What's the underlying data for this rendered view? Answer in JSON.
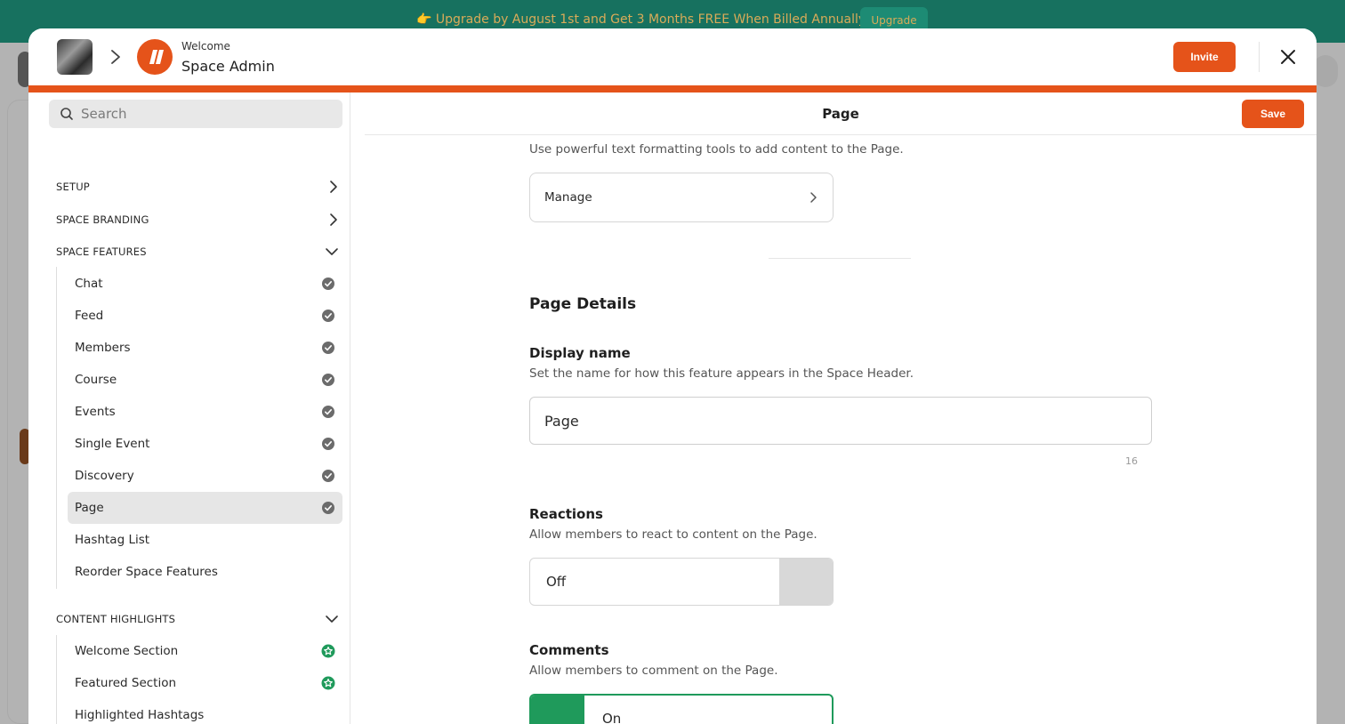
{
  "background": {
    "banner_text": "👉 Upgrade by August 1st and Get 3 Months FREE When Billed Annually",
    "banner_button": "Upgrade"
  },
  "header": {
    "breadcrumb_sub": "Welcome",
    "breadcrumb_title": "Space Admin",
    "invite_label": "Invite",
    "accent_color": "#e5531a"
  },
  "sidebar": {
    "search_placeholder": "Search",
    "sections": {
      "setup": "SETUP",
      "branding": "SPACE BRANDING",
      "features": "SPACE FEATURES",
      "highlights": "CONTENT HIGHLIGHTS"
    },
    "features": [
      {
        "label": "Chat",
        "icon": "check-circle-icon"
      },
      {
        "label": "Feed",
        "icon": "check-circle-icon"
      },
      {
        "label": "Members",
        "icon": "check-circle-icon"
      },
      {
        "label": "Course",
        "icon": "check-circle-icon"
      },
      {
        "label": "Events",
        "icon": "check-circle-icon"
      },
      {
        "label": "Single Event",
        "icon": "check-circle-icon"
      },
      {
        "label": "Discovery",
        "icon": "check-circle-icon"
      },
      {
        "label": "Page",
        "icon": "check-circle-icon",
        "active": true
      },
      {
        "label": "Hashtag List"
      },
      {
        "label": "Reorder Space Features"
      }
    ],
    "highlights": [
      {
        "label": "Welcome Section",
        "icon": "star-circle-icon"
      },
      {
        "label": "Featured Section",
        "icon": "star-circle-icon"
      },
      {
        "label": "Highlighted Hashtags"
      }
    ],
    "success_color": "#1f9a5b"
  },
  "main": {
    "title": "Page",
    "save_label": "Save",
    "content_desc": "Use powerful text formatting tools to add content to the Page.",
    "manage_label": "Manage",
    "details_title": "Page Details",
    "display_name": {
      "label": "Display name",
      "desc": "Set the name for how this feature appears in the Space Header.",
      "value": "Page",
      "char_count": "16"
    },
    "reactions": {
      "label": "Reactions",
      "desc": "Allow members to react to content on the Page.",
      "state": "Off"
    },
    "comments": {
      "label": "Comments",
      "desc": "Allow members to comment on the Page.",
      "state": "On"
    }
  }
}
